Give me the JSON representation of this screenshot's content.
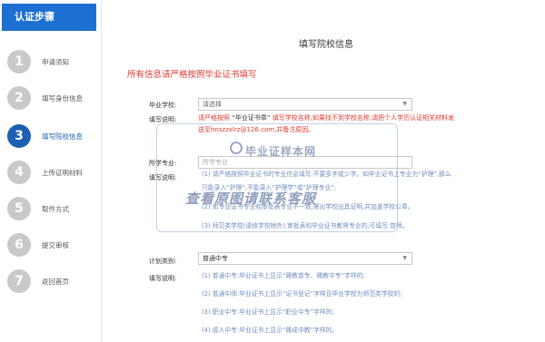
{
  "sidebar": {
    "title": "认证步骤",
    "steps": [
      {
        "num": "1",
        "label": "申请须知"
      },
      {
        "num": "2",
        "label": "填写身份信息"
      },
      {
        "num": "3",
        "label": "填写院校信息"
      },
      {
        "num": "4",
        "label": "上传证明材料"
      },
      {
        "num": "5",
        "label": "取件方式"
      },
      {
        "num": "6",
        "label": "提交审核"
      },
      {
        "num": "7",
        "label": "返回首页"
      }
    ]
  },
  "main": {
    "title": "填写院校信息",
    "notice": "所有信息请严格按照毕业证书填写",
    "school": {
      "label": "毕业学校:",
      "value": "请选择",
      "help_label": "填写说明:",
      "help_line1_a": "请严格按照",
      "help_line1_b": "“毕业证书章”",
      "help_line1_c": "填写学校名称,如果找不到学校名称,请把个人学历认证相关材料发",
      "help_line2": "送至hnszzxlrz@126.com,并备注原因。"
    },
    "major": {
      "label": "所学专业:",
      "placeholder": "所学专业",
      "help_label": "填写说明:",
      "lines": [
        "(1) 请严格按照毕业证书的专业信息填写,不要多字或少字。如毕业证书上专业为“护理”,那么",
        "只能录入“护理”,不能录入“护理学”或“护理专业”;",
        "(2) 如专业证书专业和审批表专业不一致,需出学校出具证明,并加盖学校公章。",
        "(3) 师范类学校(请修学校除外),审批表和毕业证书都将专业的,可填写:普师。"
      ]
    },
    "plan": {
      "label": "计划类别:",
      "value": "普通中专",
      "help_label": "填写说明:",
      "lines": [
        "(1) 普通中专:毕业证书上显示“赣教普专、赣教中专”字样的;",
        "(2) 普通中师:毕业证书上显示“证书登记”字样且毕业学校为师范类学校的;",
        "(3) 职业中专:毕业证书上显示“职业中专”字样的;",
        "(4) 成人中专:毕业证书上显示“赣成中教”字样的。"
      ]
    }
  },
  "watermark": {
    "logo": "毕业证样本网",
    "text": "查看原图请联系客服"
  },
  "colors": {
    "primary": "#1d6fd1",
    "active_step": "#1d5fb4",
    "inactive_step": "#c9c9c9",
    "alert_red": "#e23a2e",
    "help_blue": "#6f8fbf"
  },
  "icons": {
    "select_caret": "chevron-down-icon"
  }
}
